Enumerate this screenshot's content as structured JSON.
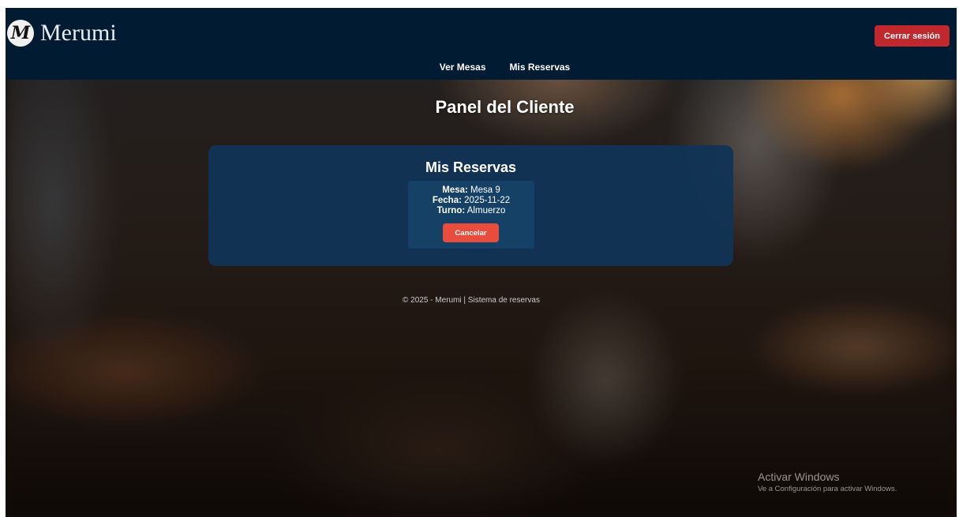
{
  "brand": {
    "logo_letter": "M",
    "name": "Merumi"
  },
  "header": {
    "logout_label": "Cerrar sesión"
  },
  "nav": {
    "items": [
      {
        "label": "Ver Mesas"
      },
      {
        "label": "Mis Reservas"
      }
    ]
  },
  "page": {
    "title": "Panel del Cliente"
  },
  "reservations": {
    "title": "Mis Reservas",
    "items": [
      {
        "mesa_label": "Mesa:",
        "mesa_value": "Mesa 9",
        "fecha_label": "Fecha:",
        "fecha_value": "2025-11-22",
        "turno_label": "Turno:",
        "turno_value": "Almuerzo",
        "cancel_label": "Cancelar"
      }
    ]
  },
  "footer": {
    "text": "© 2025 - Merumi | Sistema de reservas"
  },
  "watermark": {
    "title": "Activar Windows",
    "subtitle": "Ve a Configuración para activar Windows."
  },
  "colors": {
    "header_bg": "#011b33",
    "logout_bg": "#c0282d",
    "panel_bg": "#103456",
    "cancel_bg": "#e74c3c"
  }
}
